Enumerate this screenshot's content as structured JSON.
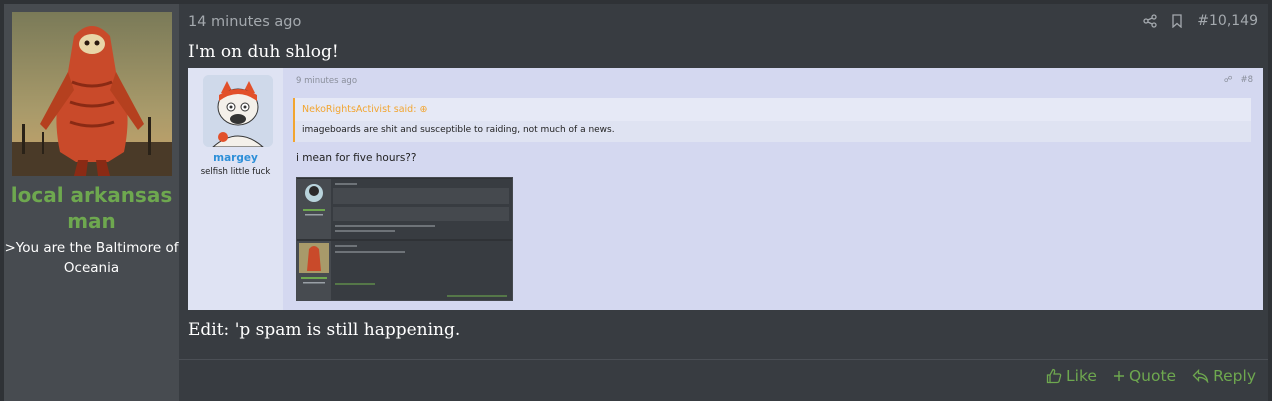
{
  "author": {
    "name": "local arkansas man",
    "title": ">You are the Baltimore of Oceania"
  },
  "post": {
    "time": "14 minutes ago",
    "number": "#10,149",
    "text_top": "I'm on duh shlog!",
    "text_bottom": "Edit: 'p spam is still happening."
  },
  "embedded_screenshot": {
    "time": "9 minutes ago",
    "number": "#8",
    "user_name": "margey",
    "user_title": "selfish little fuck",
    "quote_author": "NekoRightsActivist said:",
    "quote_text": "imageboards are shit and susceptible to raiding, not much of a news.",
    "reply_text": "i mean for five hours??"
  },
  "footer": {
    "like_label": "Like",
    "quote_label": "Quote",
    "reply_label": "Reply"
  },
  "colors": {
    "accent_green": "#6ea84f",
    "embed_bg": "#d4d8f0",
    "quote_accent": "#f2a530"
  }
}
